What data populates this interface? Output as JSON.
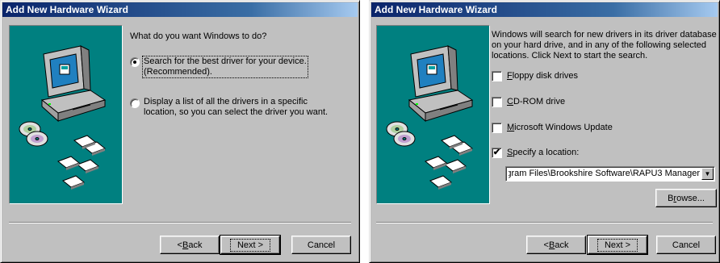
{
  "wizard1": {
    "title": "Add New Hardware Wizard",
    "question": "What do you want Windows to do?",
    "options": [
      {
        "line1": "Search for the best driver for your device.",
        "line2": "(Recommended).",
        "selected": true
      },
      {
        "line1": "Display a list of all the drivers in a specific",
        "line2": "location, so you can select the driver you want.",
        "selected": false
      }
    ],
    "buttons": {
      "back": {
        "mnemonic": "B",
        "rest": "ack",
        "prefix": "< "
      },
      "next": "Next >",
      "cancel": "Cancel"
    }
  },
  "wizard2": {
    "title": "Add New Hardware Wizard",
    "description": [
      "Windows will search for new drivers in its driver database",
      "on your hard drive, and in any of the following selected",
      "locations. Click Next to start the search."
    ],
    "checkboxes": [
      {
        "mnemonic": "F",
        "rest": "loppy disk drives",
        "checked": false
      },
      {
        "mnemonic": "C",
        "rest": "D-ROM drive",
        "checked": false
      },
      {
        "mnemonic": "M",
        "rest": "icrosoft Windows Update",
        "checked": false
      },
      {
        "mnemonic": "S",
        "rest": "pecify a location:",
        "checked": true
      }
    ],
    "location_value": "gram Files\\Brookshire Software\\RAPU3 Manager",
    "browse": {
      "mnemonic": "r",
      "prefix": "B",
      "rest": "owse..."
    },
    "buttons": {
      "back": {
        "mnemonic": "B",
        "rest": "ack",
        "prefix": "< "
      },
      "next": "Next >",
      "cancel": "Cancel"
    }
  },
  "colors": {
    "dialog_face": "#c0c0c0",
    "title_start": "#0a246a",
    "title_end": "#a6caf0",
    "art_background": "#008080"
  },
  "icons": [
    "computer-icon",
    "cd-disc-icon",
    "floppy-disk-icon",
    "checkmark-icon",
    "dropdown-arrow-icon"
  ]
}
